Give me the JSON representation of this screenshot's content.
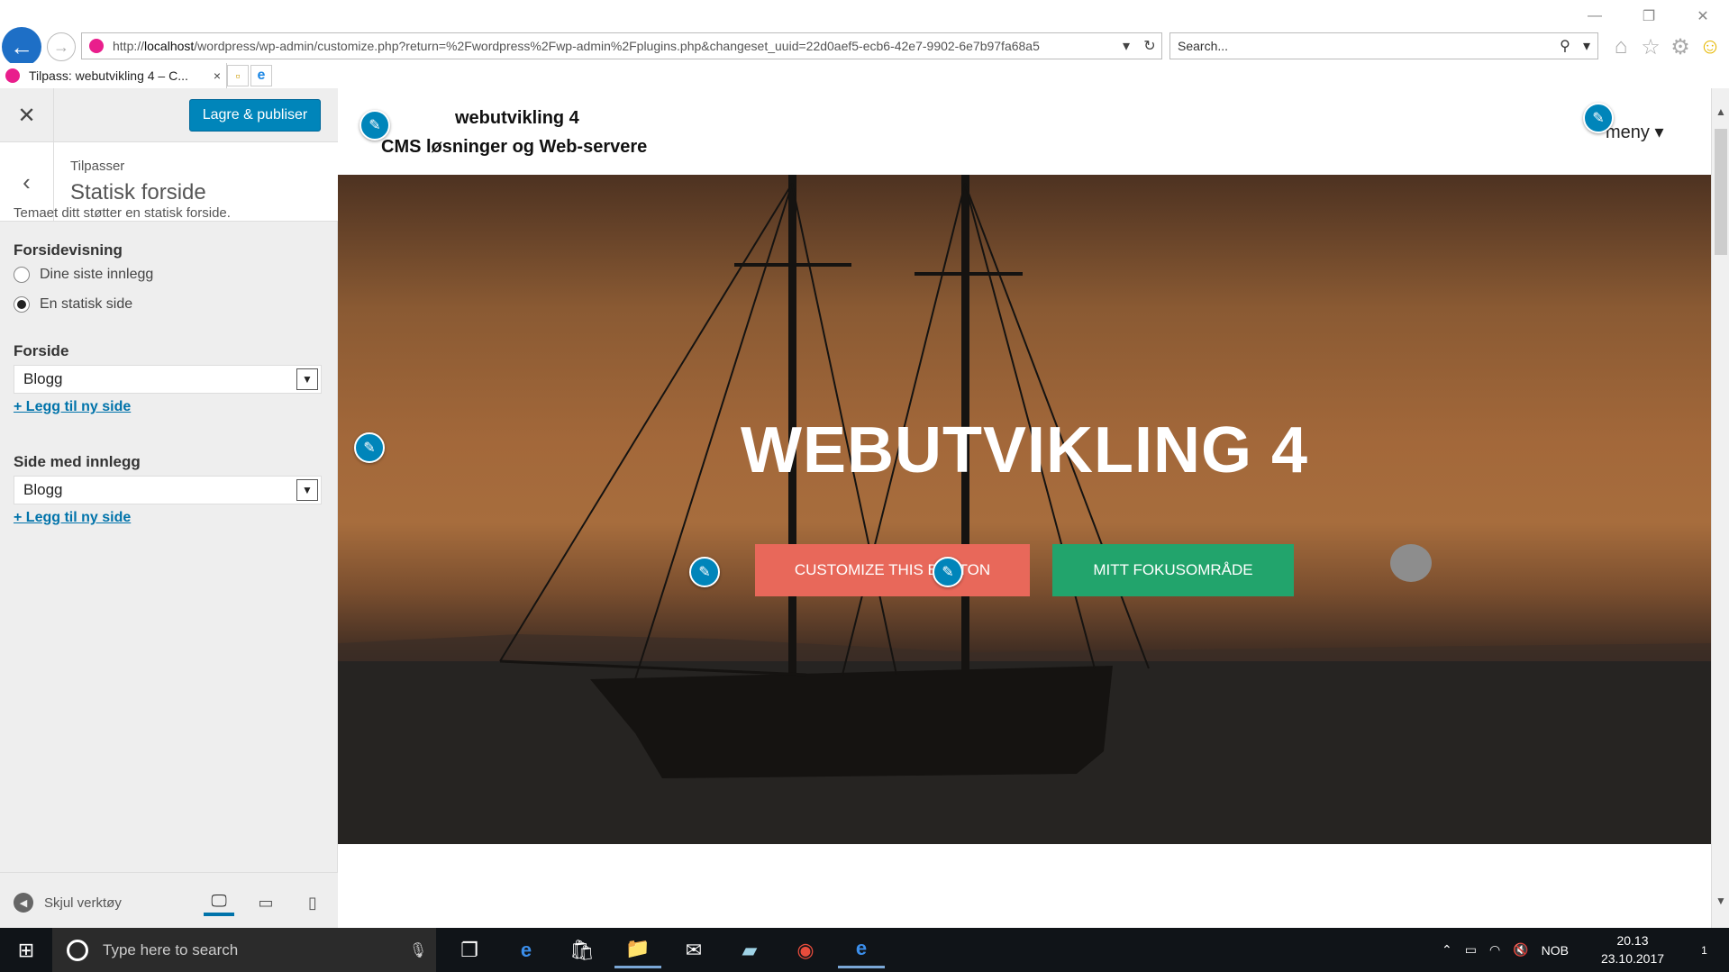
{
  "browser": {
    "url_prefix": "http://",
    "url_host": "localhost",
    "url_rest": "/wordpress/wp-admin/customize.php?return=%2Fwordpress%2Fwp-admin%2Fplugins.php&changeset_uuid=22d0aef5-ecb6-42e7-9902-6e7b97fa68a5",
    "search_placeholder": "Search...",
    "tab_title": "Tilpass: webutvikling 4 – C...",
    "tab_close": "×"
  },
  "sidebar": {
    "close_icon": "close-icon",
    "publish_label": "Lagre & publiser",
    "crumb": "Tilpasser",
    "section_title": "Statisk forside",
    "description": "Temaet ditt støtter en statisk forside.",
    "front_display_label": "Forsidevisning",
    "radio_options": [
      {
        "label": "Dine siste innlegg",
        "checked": false
      },
      {
        "label": "En statisk side",
        "checked": true
      }
    ],
    "front_page_label": "Forside",
    "front_page_value": "Blogg",
    "add_page_link": "+ Legg til ny side",
    "posts_page_label": "Side med innlegg",
    "posts_page_value": "Blogg",
    "add_page_link_2": "+ Legg til ny side",
    "hide_tools_label": "Skjul verktøy",
    "active_device": "desktop"
  },
  "preview": {
    "site_title": "webutvikling 4",
    "site_tagline": "CMS løsninger og Web-servere",
    "menu_label": "meny ▾",
    "hero_title": "WEBUTVIKLING 4",
    "button_1": "CUSTOMIZE THIS BUTTON",
    "button_2": "MITT FOKUSOMRÅDE",
    "colors": {
      "accent": "#0085ba",
      "button_1": "#e8685a",
      "button_2": "#22a46c"
    }
  },
  "taskbar": {
    "search_placeholder": "Type here to search",
    "lang": "NOB",
    "time": "20.13",
    "date": "23.10.2017",
    "notification_count": "1"
  }
}
